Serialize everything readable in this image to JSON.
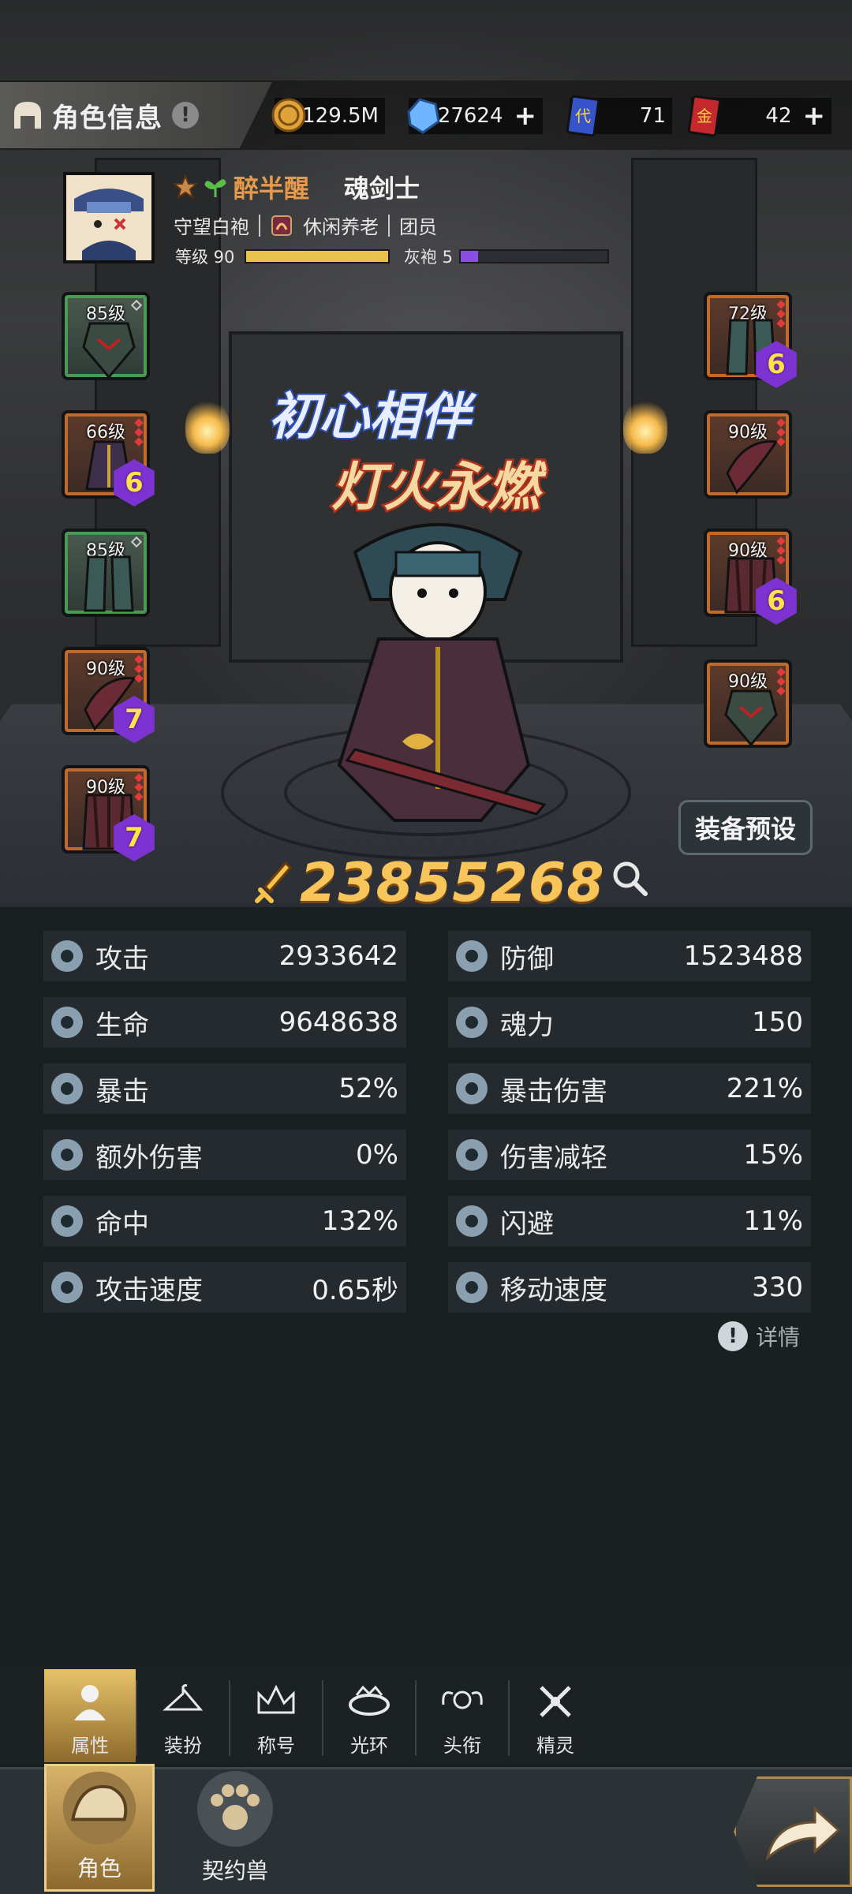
{
  "header": {
    "title": "角色信息",
    "info_icon": "!"
  },
  "currencies": [
    {
      "name": "gold-coin",
      "value": "129.5M",
      "has_plus": false
    },
    {
      "name": "diamond",
      "value": "27624",
      "has_plus": true
    },
    {
      "name": "blue-card",
      "value": "71",
      "has_plus": false
    },
    {
      "name": "gold-card",
      "value": "42",
      "has_plus": true
    }
  ],
  "profile": {
    "name": "醉半醒",
    "class": "魂剑士",
    "guild_title": "守望白袍",
    "guild_name": "休闲养老",
    "guild_role": "团员",
    "level_label": "等级 90",
    "level_progress": 1.0,
    "rank_label": "灰袍 5",
    "rank_progress": 0.12,
    "level_bar_color": "#e8c24a",
    "rank_bar_color": "#8a4fe0"
  },
  "equipment": {
    "left": [
      {
        "level": "85级",
        "tier": "",
        "frame": "green"
      },
      {
        "level": "66级",
        "tier": "6",
        "frame": "orange"
      },
      {
        "level": "85级",
        "tier": "",
        "frame": "green"
      },
      {
        "level": "90级",
        "tier": "7",
        "frame": "orange"
      },
      {
        "level": "90级",
        "tier": "7",
        "frame": "orange"
      }
    ],
    "right": [
      {
        "level": "72级",
        "tier": "6",
        "frame": "orange"
      },
      {
        "level": "90级",
        "tier": "",
        "frame": "orange"
      },
      {
        "level": "90级",
        "tier": "6",
        "frame": "orange"
      },
      {
        "level": "90级",
        "tier": "",
        "frame": "orange"
      }
    ]
  },
  "banner": {
    "line1": "初心相伴",
    "line2": "灯火永燃"
  },
  "preset_button": "装备预设",
  "power": "23855268",
  "stats": [
    {
      "name": "攻击",
      "value": "2933642",
      "icon": "sword-icon"
    },
    {
      "name": "防御",
      "value": "1523488",
      "icon": "shield-icon"
    },
    {
      "name": "生命",
      "value": "9648638",
      "icon": "heart-icon"
    },
    {
      "name": "魂力",
      "value": "150",
      "icon": "soul-icon"
    },
    {
      "name": "暴击",
      "value": "52%",
      "icon": "crit-icon"
    },
    {
      "name": "暴击伤害",
      "value": "221%",
      "icon": "burst-icon"
    },
    {
      "name": "额外伤害",
      "value": "0%",
      "icon": "extra-damage-icon"
    },
    {
      "name": "伤害减轻",
      "value": "15%",
      "icon": "damage-reduce-icon"
    },
    {
      "name": "命中",
      "value": "132%",
      "icon": "target-icon"
    },
    {
      "name": "闪避",
      "value": "11%",
      "icon": "dodge-icon"
    },
    {
      "name": "攻击速度",
      "value": "0.65秒",
      "icon": "attack-speed-icon"
    },
    {
      "name": "移动速度",
      "value": "330",
      "icon": "move-speed-icon"
    }
  ],
  "detail_label": "详情",
  "sub_tabs": [
    {
      "label": "属性",
      "icon": "person-icon",
      "active": true
    },
    {
      "label": "装扮",
      "icon": "hanger-icon",
      "active": false
    },
    {
      "label": "称号",
      "icon": "crown-icon",
      "active": false
    },
    {
      "label": "光环",
      "icon": "halo-icon",
      "active": false
    },
    {
      "label": "头衔",
      "icon": "skull-wings-icon",
      "active": false
    },
    {
      "label": "精灵",
      "icon": "fairy-icon",
      "active": false
    }
  ],
  "nav_tabs": [
    {
      "label": "角色",
      "icon": "character-icon",
      "active": true
    },
    {
      "label": "契约兽",
      "icon": "paw-icon",
      "active": false
    }
  ]
}
